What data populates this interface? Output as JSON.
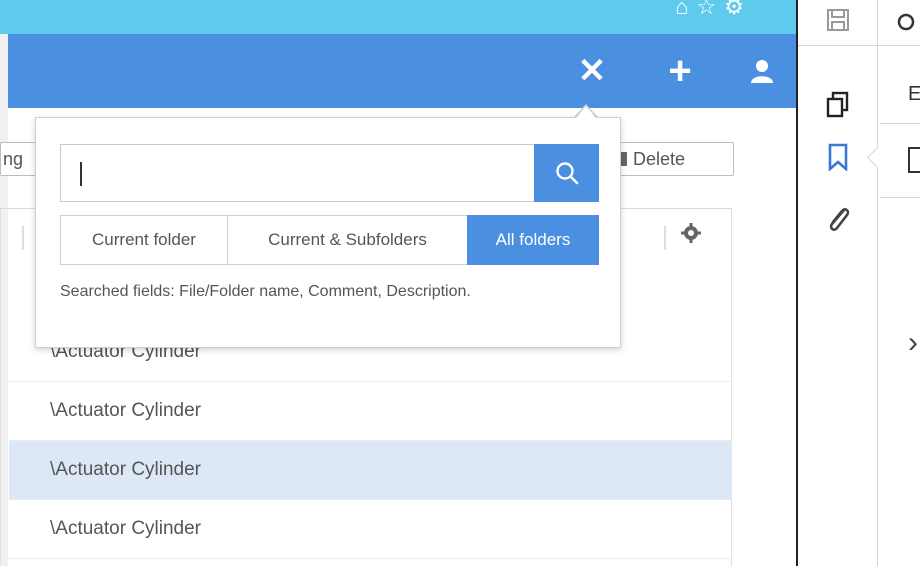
{
  "app_bar": {
    "close_glyph": "✕",
    "add_glyph": "+"
  },
  "toolbar": {
    "partial_label": "ng",
    "delete_label": "Delete"
  },
  "search_popover": {
    "input_value": "",
    "scopes": [
      "Current folder",
      "Current & Subfolders",
      "All folders"
    ],
    "active_scope": "All folders",
    "hint": "Searched fields: File/Folder name, Comment, Description."
  },
  "rows": [
    "\\Actuator Cylinder",
    "\\Actuator Cylinder",
    "\\Actuator Cylinder",
    "\\Actuator Cylinder"
  ],
  "side_panel": {
    "top_text": "E",
    "arrow_text": "›"
  },
  "colors": {
    "accent": "#4b8fe0",
    "browser_strip": "#5fcbec",
    "selected_row": "#dde8f7"
  }
}
